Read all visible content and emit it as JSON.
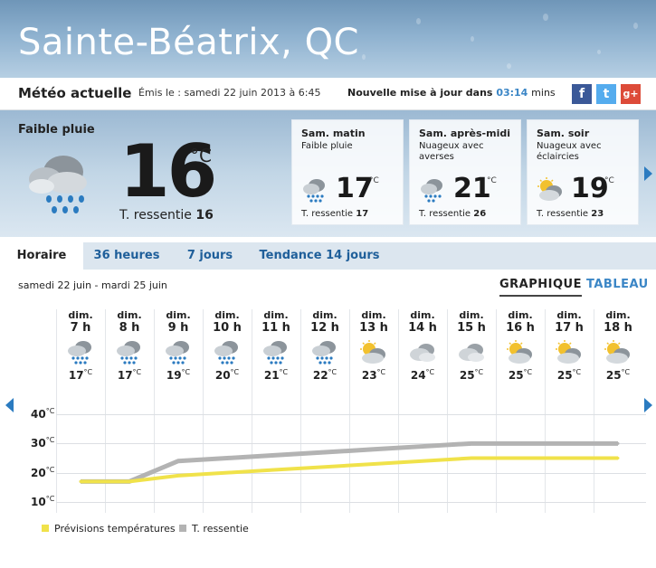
{
  "location": {
    "title": "Sainte-Béatrix, QC"
  },
  "meteo_bar": {
    "title": "Météo actuelle",
    "issued": "Émis le : samedi 22 juin 2013 à 6:45",
    "update_prefix": "Nouvelle mise à jour dans",
    "update_time": "03:14",
    "update_suffix": "mins",
    "social": [
      "f",
      "t",
      "g+"
    ]
  },
  "current": {
    "condition": "Faible pluie",
    "temp": "16",
    "unit": "°C",
    "feels_label": "T. ressentie",
    "feels_value": "16",
    "icon": "light-rain-icon"
  },
  "forecast_cards": [
    {
      "period": "Sam. matin",
      "condition": "Faible pluie",
      "temp": "17",
      "unit": "°C",
      "feels_label": "T. ressentie",
      "feels": "17",
      "icon": "rain-cloud-icon"
    },
    {
      "period": "Sam. après-midi",
      "condition": "Nuageux avec averses",
      "temp": "21",
      "unit": "°C",
      "feels_label": "T. ressentie",
      "feels": "26",
      "icon": "rain-cloud-icon"
    },
    {
      "period": "Sam. soir",
      "condition": "Nuageux avec éclaircies",
      "temp": "19",
      "unit": "°C",
      "feels_label": "T. ressentie",
      "feels": "23",
      "icon": "sun-cloud-icon"
    }
  ],
  "tabs": [
    "Horaire",
    "36 heures",
    "7 jours",
    "Tendance 14 jours"
  ],
  "active_tab": "Horaire",
  "date_range": "samedi 22 juin - mardi 25 juin",
  "view_tabs": {
    "graph": "GRAPHIQUE",
    "table": "TABLEAU"
  },
  "hourly": [
    {
      "day": "dim.",
      "hour": "7 h",
      "temp": "17",
      "icon": "rain-cloud-icon"
    },
    {
      "day": "dim.",
      "hour": "8 h",
      "temp": "17",
      "icon": "rain-cloud-icon"
    },
    {
      "day": "dim.",
      "hour": "9 h",
      "temp": "19",
      "icon": "rain-cloud-icon"
    },
    {
      "day": "dim.",
      "hour": "10 h",
      "temp": "20",
      "icon": "rain-cloud-icon"
    },
    {
      "day": "dim.",
      "hour": "11 h",
      "temp": "21",
      "icon": "rain-cloud-icon"
    },
    {
      "day": "dim.",
      "hour": "12 h",
      "temp": "22",
      "icon": "rain-cloud-icon"
    },
    {
      "day": "dim.",
      "hour": "13 h",
      "temp": "23",
      "icon": "sun-cloud-icon"
    },
    {
      "day": "dim.",
      "hour": "14 h",
      "temp": "24",
      "icon": "cloud-icon"
    },
    {
      "day": "dim.",
      "hour": "15 h",
      "temp": "25",
      "icon": "cloud-icon"
    },
    {
      "day": "dim.",
      "hour": "16 h",
      "temp": "25",
      "icon": "sun-cloud-icon"
    },
    {
      "day": "dim.",
      "hour": "17 h",
      "temp": "25",
      "icon": "sun-cloud-icon"
    },
    {
      "day": "dim.",
      "hour": "18 h",
      "temp": "25",
      "icon": "sun-cloud-icon"
    }
  ],
  "unit_small": "°C",
  "chart_data": {
    "type": "line",
    "categories": [
      "7 h",
      "8 h",
      "9 h",
      "10 h",
      "11 h",
      "12 h",
      "13 h",
      "14 h",
      "15 h",
      "16 h",
      "17 h",
      "18 h"
    ],
    "series": [
      {
        "name": "Prévisions températures",
        "values": [
          17,
          17,
          19,
          20,
          21,
          22,
          23,
          24,
          25,
          25,
          25,
          25
        ],
        "color": "#f0e24a"
      },
      {
        "name": "T. ressentie",
        "values": [
          17,
          17,
          24,
          25,
          26,
          27,
          28,
          29,
          30,
          30,
          30,
          30
        ],
        "color": "#b3b3b3"
      }
    ],
    "y_ticks": [
      {
        "value": 40,
        "label": "40"
      },
      {
        "value": 30,
        "label": "30"
      },
      {
        "value": 20,
        "label": "20"
      },
      {
        "value": 10,
        "label": "10"
      }
    ],
    "ylim": [
      10,
      40
    ],
    "grid": true,
    "legend": "bottom-left"
  },
  "colors": {
    "link": "#3b86c6",
    "tab_bg": "#dce6ef",
    "facebook": "#3b5998",
    "twitter": "#55acee",
    "googleplus": "#dd4b39"
  }
}
